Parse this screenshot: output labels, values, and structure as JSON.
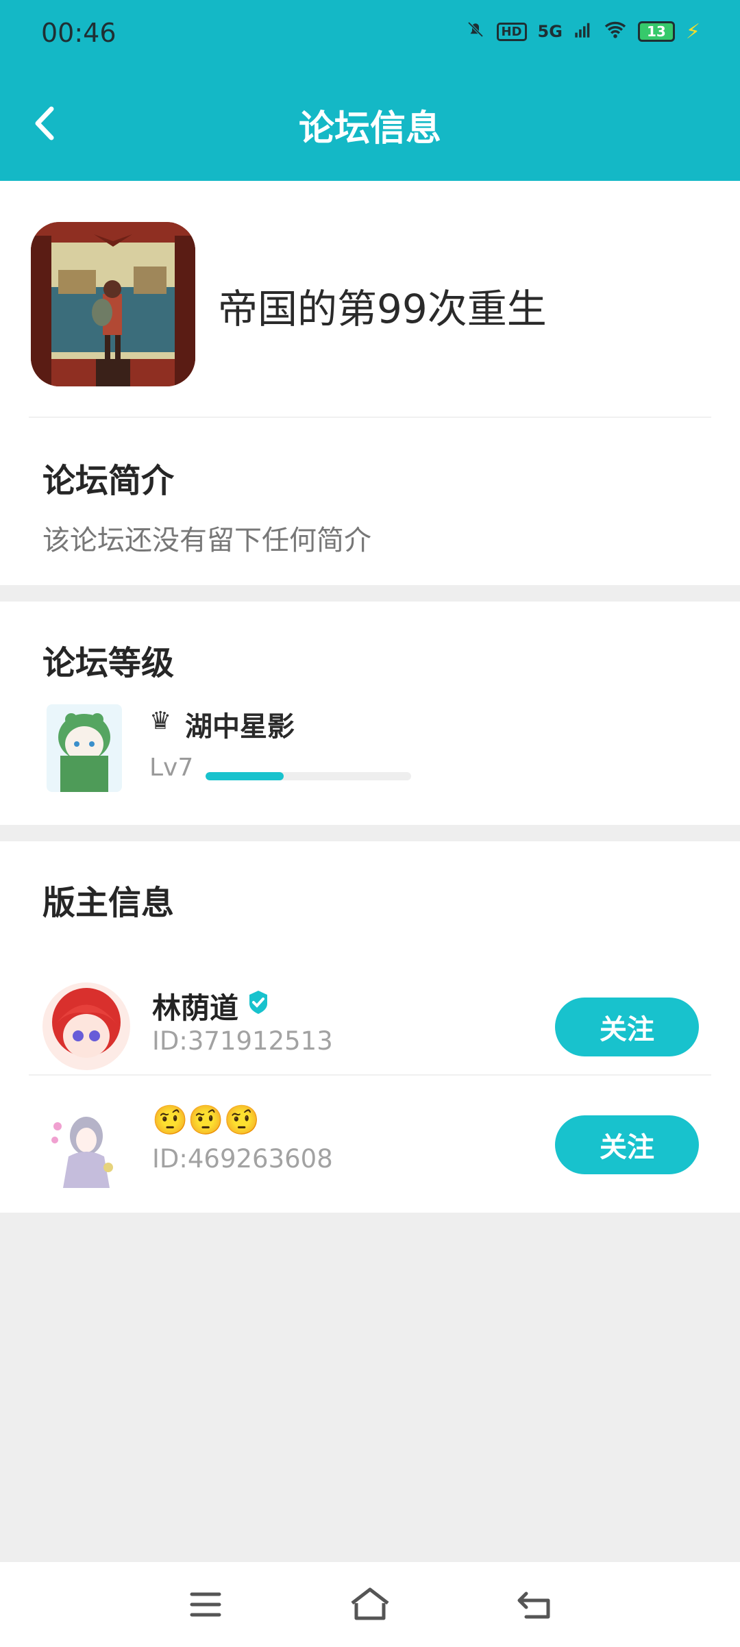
{
  "status": {
    "time": "00:46",
    "network": "5G",
    "hd": "HD",
    "battery": "13"
  },
  "header": {
    "title": "论坛信息",
    "back_icon": "chevron-left-icon"
  },
  "forum": {
    "name": "帝国的第99次重生",
    "intro_title": "论坛简介",
    "intro_text": "该论坛还没有留下任何简介"
  },
  "level": {
    "title": "论坛等级",
    "user_name": "湖中星影",
    "level_label": "Lv7",
    "progress": 0.38,
    "crown_icon": "crown-icon"
  },
  "moderators": {
    "title": "版主信息",
    "items": [
      {
        "name": "林荫道",
        "id": "ID:371912513",
        "verified": true,
        "follow_label": "关注"
      },
      {
        "name": "🤨🤨🤨",
        "id": "ID:469263608",
        "verified": false,
        "follow_label": "关注"
      }
    ]
  },
  "colors": {
    "accent": "#14b8c6",
    "button": "#18c2cd",
    "background": "#eeeeee"
  },
  "navigation": {
    "menu_icon": "menu-icon",
    "home_icon": "home-icon",
    "back_icon": "back-icon"
  }
}
